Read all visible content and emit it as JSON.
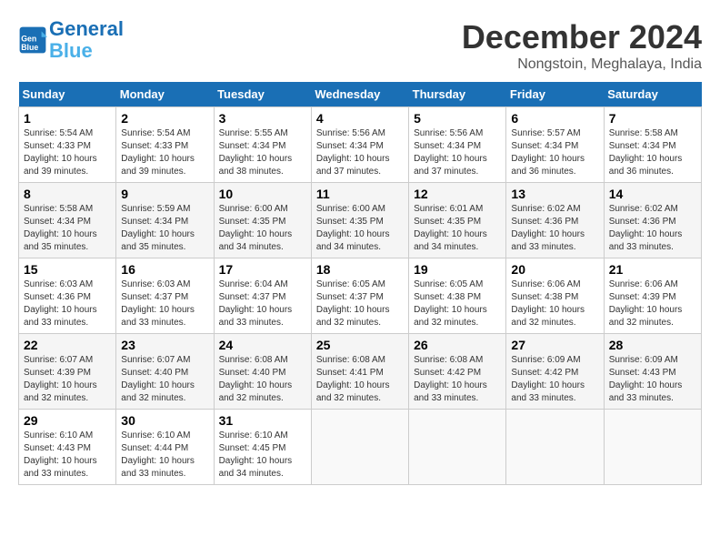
{
  "header": {
    "logo_line1": "General",
    "logo_line2": "Blue",
    "month": "December 2024",
    "location": "Nongstoin, Meghalaya, India"
  },
  "columns": [
    "Sunday",
    "Monday",
    "Tuesday",
    "Wednesday",
    "Thursday",
    "Friday",
    "Saturday"
  ],
  "weeks": [
    [
      {
        "day": "1",
        "sunrise": "5:54 AM",
        "sunset": "4:33 PM",
        "daylight": "10 hours and 39 minutes."
      },
      {
        "day": "2",
        "sunrise": "5:54 AM",
        "sunset": "4:33 PM",
        "daylight": "10 hours and 39 minutes."
      },
      {
        "day": "3",
        "sunrise": "5:55 AM",
        "sunset": "4:34 PM",
        "daylight": "10 hours and 38 minutes."
      },
      {
        "day": "4",
        "sunrise": "5:56 AM",
        "sunset": "4:34 PM",
        "daylight": "10 hours and 37 minutes."
      },
      {
        "day": "5",
        "sunrise": "5:56 AM",
        "sunset": "4:34 PM",
        "daylight": "10 hours and 37 minutes."
      },
      {
        "day": "6",
        "sunrise": "5:57 AM",
        "sunset": "4:34 PM",
        "daylight": "10 hours and 36 minutes."
      },
      {
        "day": "7",
        "sunrise": "5:58 AM",
        "sunset": "4:34 PM",
        "daylight": "10 hours and 36 minutes."
      }
    ],
    [
      {
        "day": "8",
        "sunrise": "5:58 AM",
        "sunset": "4:34 PM",
        "daylight": "10 hours and 35 minutes."
      },
      {
        "day": "9",
        "sunrise": "5:59 AM",
        "sunset": "4:34 PM",
        "daylight": "10 hours and 35 minutes."
      },
      {
        "day": "10",
        "sunrise": "6:00 AM",
        "sunset": "4:35 PM",
        "daylight": "10 hours and 34 minutes."
      },
      {
        "day": "11",
        "sunrise": "6:00 AM",
        "sunset": "4:35 PM",
        "daylight": "10 hours and 34 minutes."
      },
      {
        "day": "12",
        "sunrise": "6:01 AM",
        "sunset": "4:35 PM",
        "daylight": "10 hours and 34 minutes."
      },
      {
        "day": "13",
        "sunrise": "6:02 AM",
        "sunset": "4:36 PM",
        "daylight": "10 hours and 33 minutes."
      },
      {
        "day": "14",
        "sunrise": "6:02 AM",
        "sunset": "4:36 PM",
        "daylight": "10 hours and 33 minutes."
      }
    ],
    [
      {
        "day": "15",
        "sunrise": "6:03 AM",
        "sunset": "4:36 PM",
        "daylight": "10 hours and 33 minutes."
      },
      {
        "day": "16",
        "sunrise": "6:03 AM",
        "sunset": "4:37 PM",
        "daylight": "10 hours and 33 minutes."
      },
      {
        "day": "17",
        "sunrise": "6:04 AM",
        "sunset": "4:37 PM",
        "daylight": "10 hours and 33 minutes."
      },
      {
        "day": "18",
        "sunrise": "6:05 AM",
        "sunset": "4:37 PM",
        "daylight": "10 hours and 32 minutes."
      },
      {
        "day": "19",
        "sunrise": "6:05 AM",
        "sunset": "4:38 PM",
        "daylight": "10 hours and 32 minutes."
      },
      {
        "day": "20",
        "sunrise": "6:06 AM",
        "sunset": "4:38 PM",
        "daylight": "10 hours and 32 minutes."
      },
      {
        "day": "21",
        "sunrise": "6:06 AM",
        "sunset": "4:39 PM",
        "daylight": "10 hours and 32 minutes."
      }
    ],
    [
      {
        "day": "22",
        "sunrise": "6:07 AM",
        "sunset": "4:39 PM",
        "daylight": "10 hours and 32 minutes."
      },
      {
        "day": "23",
        "sunrise": "6:07 AM",
        "sunset": "4:40 PM",
        "daylight": "10 hours and 32 minutes."
      },
      {
        "day": "24",
        "sunrise": "6:08 AM",
        "sunset": "4:40 PM",
        "daylight": "10 hours and 32 minutes."
      },
      {
        "day": "25",
        "sunrise": "6:08 AM",
        "sunset": "4:41 PM",
        "daylight": "10 hours and 32 minutes."
      },
      {
        "day": "26",
        "sunrise": "6:08 AM",
        "sunset": "4:42 PM",
        "daylight": "10 hours and 33 minutes."
      },
      {
        "day": "27",
        "sunrise": "6:09 AM",
        "sunset": "4:42 PM",
        "daylight": "10 hours and 33 minutes."
      },
      {
        "day": "28",
        "sunrise": "6:09 AM",
        "sunset": "4:43 PM",
        "daylight": "10 hours and 33 minutes."
      }
    ],
    [
      {
        "day": "29",
        "sunrise": "6:10 AM",
        "sunset": "4:43 PM",
        "daylight": "10 hours and 33 minutes."
      },
      {
        "day": "30",
        "sunrise": "6:10 AM",
        "sunset": "4:44 PM",
        "daylight": "10 hours and 33 minutes."
      },
      {
        "day": "31",
        "sunrise": "6:10 AM",
        "sunset": "4:45 PM",
        "daylight": "10 hours and 34 minutes."
      },
      null,
      null,
      null,
      null
    ]
  ]
}
